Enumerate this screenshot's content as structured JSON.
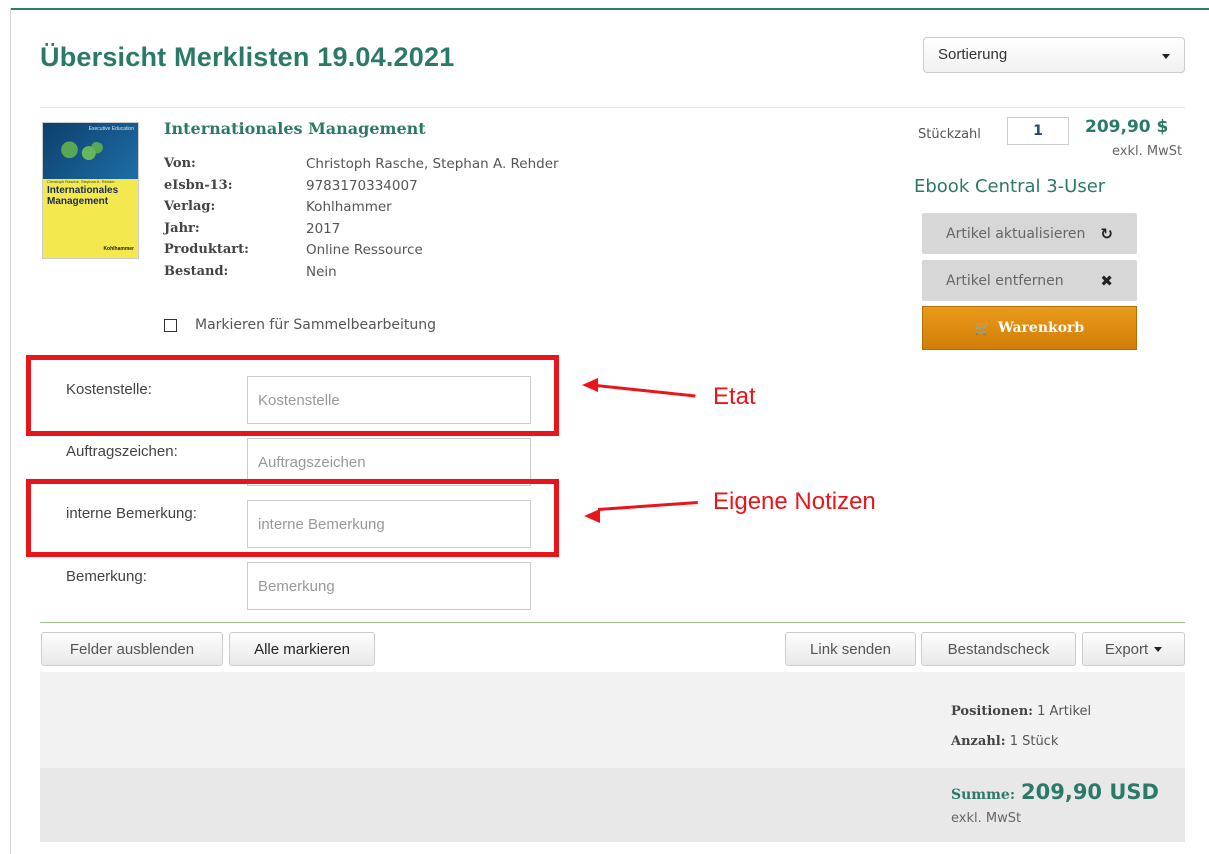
{
  "page": {
    "title": "Übersicht Merklisten 19.04.2021"
  },
  "sort": {
    "selected": "Sortierung"
  },
  "item": {
    "cover": {
      "series": "Executive Education",
      "authors": "Christoph Rasche, Stephan A. Rehder",
      "title": "Internationales Management",
      "publisher": "Kohlhammer"
    },
    "title": "Internationales Management",
    "meta": [
      {
        "label": "Von:",
        "value": "Christoph Rasche, Stephan A. Rehder"
      },
      {
        "label": "eIsbn-13:",
        "value": "9783170334007"
      },
      {
        "label": "Verlag:",
        "value": "Kohlhammer"
      },
      {
        "label": "Jahr:",
        "value": "2017"
      },
      {
        "label": "Produktart:",
        "value": "Online Ressource"
      },
      {
        "label": "Bestand:",
        "value": "Nein"
      }
    ],
    "mark_label": "Markieren für Sammelbearbeitung",
    "qty_label": "Stückzahl",
    "qty_value": "1",
    "price": "209,90 $",
    "price_note": "exkl. MwSt",
    "license": "Ebook Central 3-User",
    "update_label": "Artikel aktualisieren",
    "remove_label": "Artikel entfernen",
    "cart_label": "Warenkorb"
  },
  "fields": [
    {
      "label": "Kostenstelle:",
      "placeholder": "Kostenstelle"
    },
    {
      "label": "Auftragszeichen:",
      "placeholder": "Auftragszeichen"
    },
    {
      "label": "interne Bemerkung:",
      "placeholder": "interne Bemerkung"
    },
    {
      "label": "Bemerkung:",
      "placeholder": "Bemerkung"
    }
  ],
  "annotations": {
    "etat": "Etat",
    "notes": "Eigene Notizen"
  },
  "toolbar": {
    "hide_fields": "Felder ausblenden",
    "mark_all": "Alle markieren",
    "send_link": "Link senden",
    "stock_check": "Bestandscheck",
    "export": "Export"
  },
  "summary": {
    "positions_label": "Positionen:",
    "positions_value": "1 Artikel",
    "count_label": "Anzahl:",
    "count_value": "1 Stück",
    "total_label": "Summe:",
    "total_value": "209,90 USD",
    "total_note": "exkl. MwSt"
  },
  "colors": {
    "accent": "#2b7a67",
    "cart": "#e08c10",
    "annotation": "#e8161a"
  }
}
